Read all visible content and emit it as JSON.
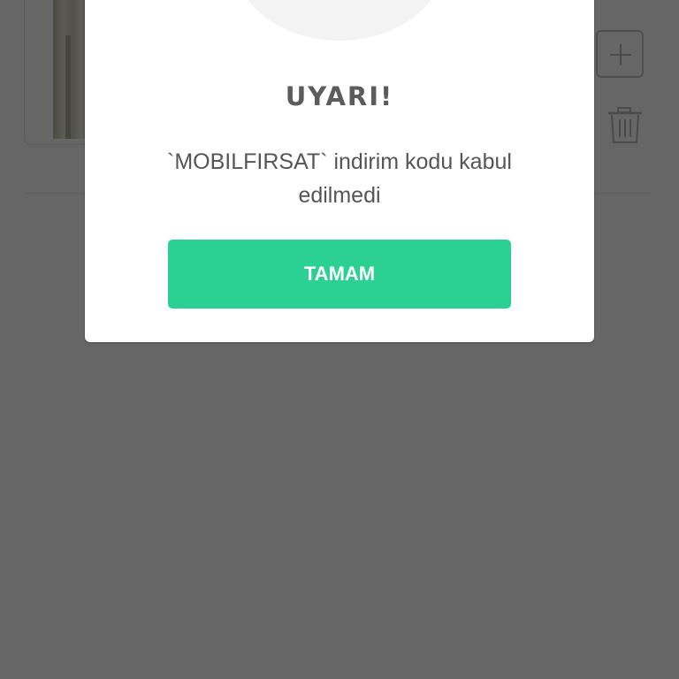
{
  "background": {
    "page_color": "#666666",
    "icons": {
      "add": "plus-icon",
      "delete": "trash-icon"
    }
  },
  "modal": {
    "title": "UYARI!",
    "message": "`MOBILFIRSAT` indirim kodu kabul edilmedi",
    "ok_button_label": "TAMAM",
    "icon": "sad-face-icon",
    "colors": {
      "accent": "#2bd093",
      "mouth": "#e8465a",
      "text": "#555555"
    }
  }
}
